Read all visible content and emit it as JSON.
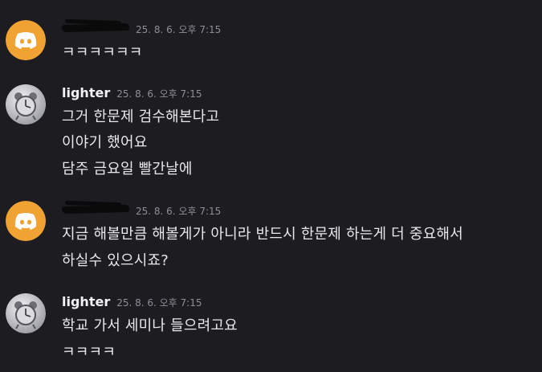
{
  "messages": [
    {
      "author": "",
      "author_redacted": true,
      "avatar_icon": "discord-icon",
      "timestamp": "25. 8. 6. 오후 7:15",
      "lines": [
        "ㅋㅋㅋㅋㅋㅋ"
      ]
    },
    {
      "author": "lighter",
      "author_redacted": false,
      "avatar_icon": "alarm-clock-avatar-icon",
      "timestamp": "25. 8. 6. 오후 7:15",
      "lines": [
        "그거 한문제 검수해본다고",
        "이야기 했어요",
        "담주 금요일 빨간날에"
      ]
    },
    {
      "author": "",
      "author_redacted": true,
      "avatar_icon": "discord-icon",
      "timestamp": "25. 8. 6. 오후 7:15",
      "lines": [
        "지금 해볼만큼 해볼게가 아니라 반드시 한문제 하는게 더 중요해서",
        "하실수 있으시죠?"
      ]
    },
    {
      "author": "lighter",
      "author_redacted": false,
      "avatar_icon": "alarm-clock-avatar-icon",
      "timestamp": "25. 8. 6. 오후 7:15",
      "lines": [
        "학교 가서 세미나 들으려고요",
        "ㅋㅋㅋㅋ"
      ]
    }
  ],
  "colors": {
    "background": "#1c1c21",
    "discord_avatar_bg": "#f0a232",
    "text": "#e8e8ec",
    "timestamp": "#8e9096"
  }
}
